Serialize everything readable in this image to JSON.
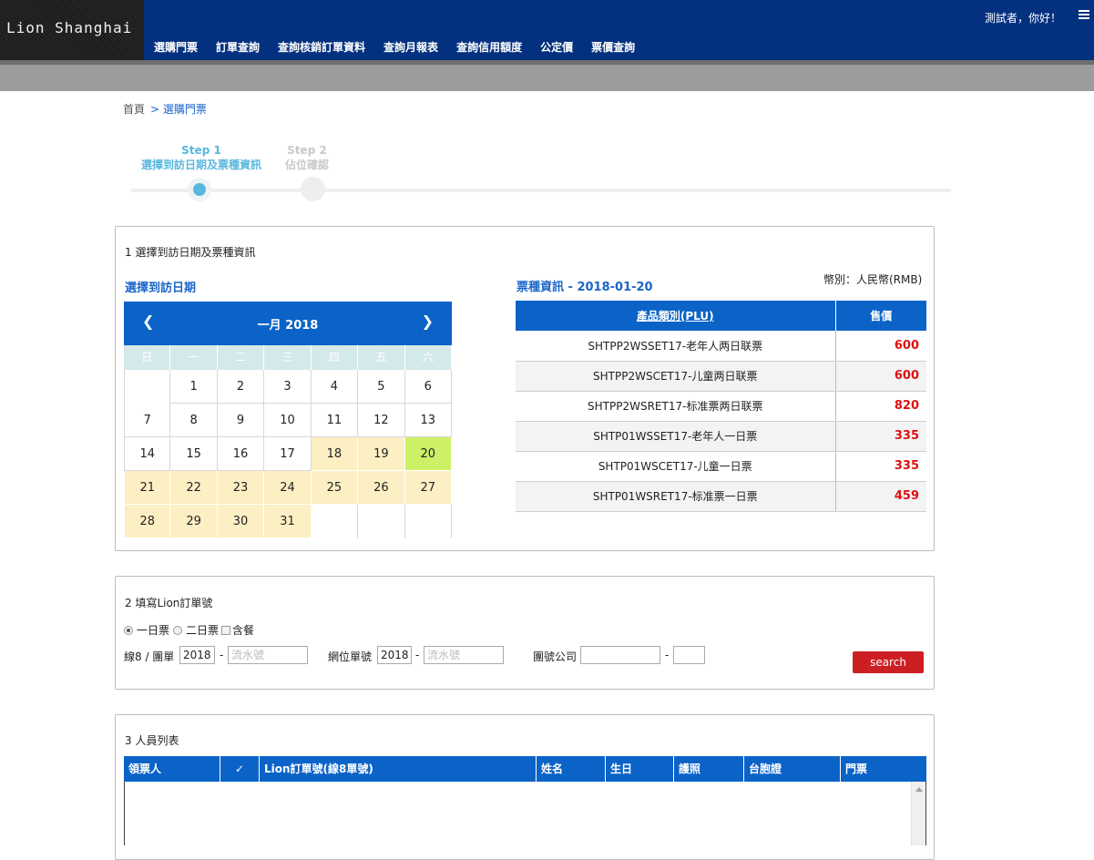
{
  "header": {
    "logo": "Lion Shanghai",
    "nav": [
      "選購門票",
      "訂單查詢",
      "查詢核銷訂單資料",
      "查詢月報表",
      "查詢信用額度",
      "公定價",
      "票價查詢"
    ],
    "greeting": "測試者，你好！",
    "menu_icon": "hamburger-icon"
  },
  "breadcrumb": {
    "home": "首頁",
    "current": "> 選購門票"
  },
  "steps": [
    {
      "label": "Step 1",
      "desc": "選擇到訪日期及票種資訊",
      "active": true
    },
    {
      "label": "Step 2",
      "desc": "佔位確認",
      "active": false
    }
  ],
  "panel1": {
    "title": "1 選擇到訪日期及票種資訊",
    "date_title": "選擇到訪日期",
    "ticket_title": "票種資訊 - 2018-01-20",
    "currency": "幣別：人民幣(RMB)"
  },
  "calendar": {
    "month": "一月 2018",
    "prev": "❮",
    "next": "❯",
    "dow": [
      "日",
      "一",
      "二",
      "三",
      "四",
      "五",
      "六"
    ],
    "cells": [
      "",
      "1",
      "2",
      "3",
      "4",
      "5",
      "6",
      "7",
      "8",
      "9",
      "10",
      "11",
      "12",
      "13",
      "14",
      "15",
      "16",
      "17",
      "18",
      "19",
      "20",
      "21",
      "22",
      "23",
      "24",
      "25",
      "26",
      "27",
      "28",
      "29",
      "30",
      "31",
      "",
      "",
      ""
    ],
    "available": [
      "18",
      "19",
      "21",
      "22",
      "23",
      "24",
      "25",
      "26",
      "27",
      "28",
      "29",
      "30",
      "31"
    ],
    "selected": "20",
    "colors": {
      "header": "#0b63c7",
      "available": "#fdefc4",
      "selected": "#ccf066"
    }
  },
  "price_table": {
    "headers": [
      "產品類別(PLU)",
      "售價"
    ],
    "rows": [
      {
        "name": "SHTPP2WSSET17-老年人两日联票",
        "price": "600"
      },
      {
        "name": "SHTPP2WSCET17-儿童两日联票",
        "price": "600"
      },
      {
        "name": "SHTPP2WSRET17-标准票两日联票",
        "price": "820"
      },
      {
        "name": "SHTP01WSSET17-老年人一日票",
        "price": "335"
      },
      {
        "name": "SHTP01WSCET17-儿童一日票",
        "price": "335"
      },
      {
        "name": "SHTP01WSRET17-标准票一日票",
        "price": "459"
      }
    ]
  },
  "panel2": {
    "title": "2 填寫Lion訂單號",
    "radios": [
      "一日票",
      "二日票"
    ],
    "checkbox": "含餐",
    "line8_label": "線8 / 團單",
    "line8_year": "2018",
    "serial_placeholder": "流水號",
    "web_label": "網位單號",
    "web_year": "2018",
    "company_label": "團號公司",
    "dash": "-",
    "search": "search"
  },
  "panel3": {
    "title": "3 人員列表",
    "columns": [
      "領票人",
      "✓",
      "Lion訂單號(線8單號)",
      "姓名",
      "生日",
      "護照",
      "台胞證",
      "門票"
    ]
  }
}
